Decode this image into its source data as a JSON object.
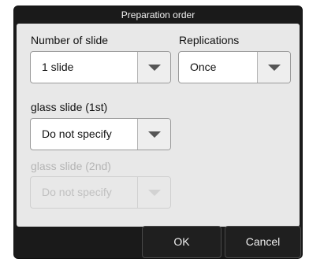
{
  "dialog": {
    "title": "Preparation order"
  },
  "number_of_slide": {
    "label": "Number of slide",
    "value": "1 slide"
  },
  "replications": {
    "label": "Replications",
    "value": "Once"
  },
  "glass_slide_1": {
    "label": "glass slide (1st)",
    "value": "Do not specify"
  },
  "glass_slide_2": {
    "label": "glass slide (2nd)",
    "value": "Do not specify",
    "enabled": false
  },
  "footer": {
    "ok_label": "OK",
    "cancel_label": "Cancel"
  },
  "icons": {
    "dropdown_arrow": "chevron-down-icon"
  }
}
